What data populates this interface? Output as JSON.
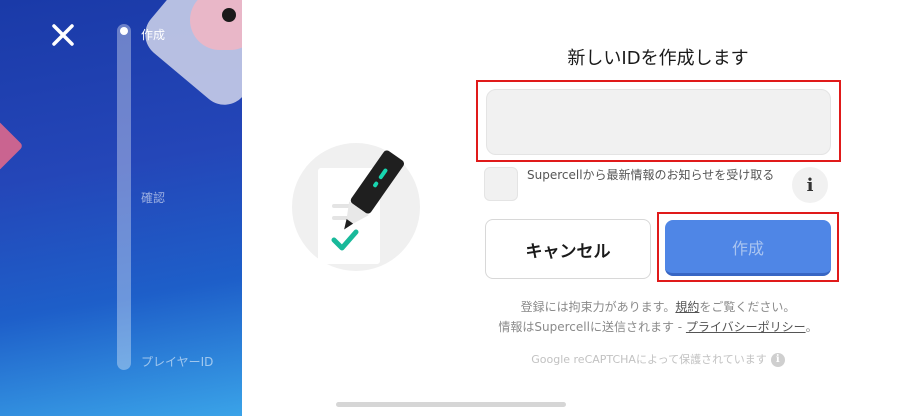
{
  "sidebar": {
    "steps": [
      {
        "label": "作成",
        "active": true
      },
      {
        "label": "確認",
        "active": false
      },
      {
        "label": "プレイヤーID",
        "active": false
      }
    ],
    "close_icon": "close-icon",
    "colors": {
      "gradient_top": "#1a3aa8",
      "gradient_bottom": "#3aa3e8"
    }
  },
  "form": {
    "title": "新しいIDを作成します",
    "id_input": {
      "value": "",
      "placeholder": ""
    },
    "newsletter": {
      "checked": false,
      "text": "Supercellから最新情報のお知らせを受け取る"
    },
    "info_label": "i",
    "cancel_label": "キャンセル",
    "create_label": "作成",
    "create_color": "#4f86e6",
    "highlight_color": "#e01a1a"
  },
  "terms": {
    "line1_prefix": "登録には拘束力があります。",
    "terms_link": "規約",
    "line1_suffix": "をご覧ください。",
    "line2_prefix": "情報はSupercellに送信されます - ",
    "privacy_link": "プライバシーポリシー",
    "line2_suffix": "。"
  },
  "captcha": {
    "text": "Google reCAPTCHAによって保護されています",
    "info_label": "i"
  },
  "illustration": {
    "icon": "pen-document-check-icon"
  }
}
